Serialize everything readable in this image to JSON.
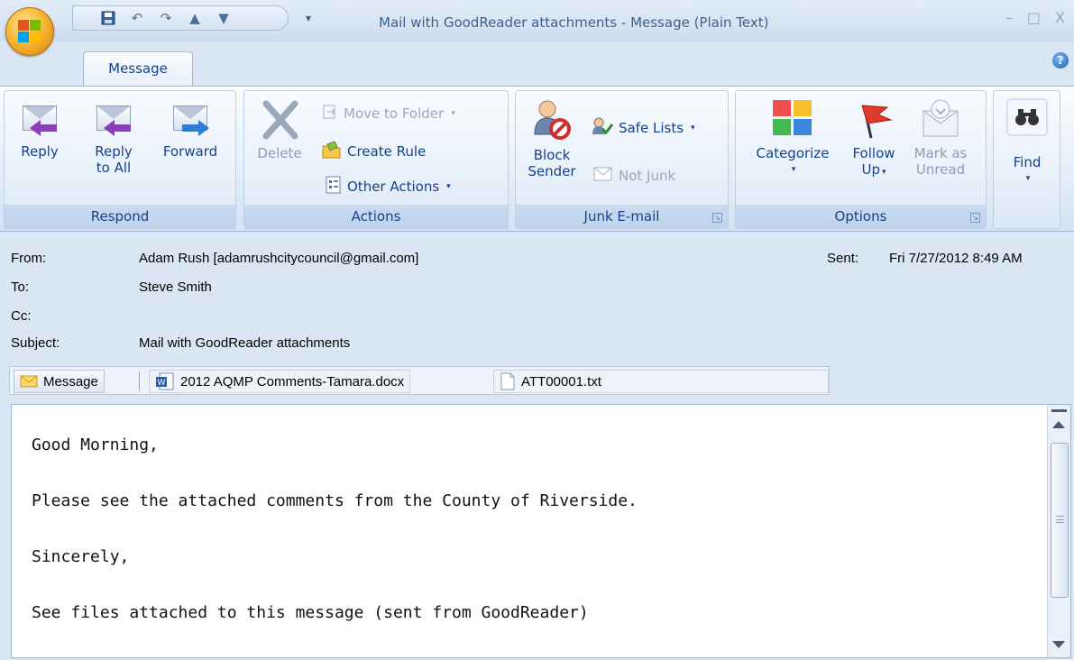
{
  "window": {
    "title": "Mail with GoodReader attachments - Message (Plain Text)",
    "controls": [
      "–",
      "□",
      "X"
    ]
  },
  "quick_access": {
    "icons": [
      "save-icon",
      "undo-icon",
      "redo-icon",
      "up-arrow-icon",
      "down-arrow-icon"
    ],
    "dropdown": "▾"
  },
  "ribbon": {
    "active_tab": "Message",
    "help": "?",
    "groups": {
      "respond": {
        "label": "Respond",
        "reply": "Reply",
        "reply_all_line1": "Reply",
        "reply_all_line2": "to All",
        "forward": "Forward"
      },
      "actions": {
        "label": "Actions",
        "delete": "Delete",
        "move_to_folder": "Move to Folder",
        "create_rule": "Create Rule",
        "other_actions": "Other Actions"
      },
      "junk": {
        "label": "Junk E-mail",
        "block_line1": "Block",
        "block_line2": "Sender",
        "safe_lists": "Safe Lists",
        "not_junk": "Not Junk"
      },
      "options": {
        "label": "Options",
        "categorize": "Categorize",
        "follow_line1": "Follow",
        "follow_line2": "Up",
        "mark_line1": "Mark as",
        "mark_line2": "Unread"
      },
      "find": {
        "label": "Find"
      }
    },
    "colors": {
      "accent": "#15428b",
      "reply_arrow": "#8a3fb8",
      "forward_arrow": "#2f7cd6"
    }
  },
  "headers": {
    "from_label": "From:",
    "from_value": "Adam Rush [adamrushcitycouncil@gmail.com]",
    "to_label": "To:",
    "to_value": "Steve Smith",
    "cc_label": "Cc:",
    "subject_label": "Subject:",
    "subject_value": "Mail with GoodReader attachments",
    "sent_label": "Sent:",
    "sent_value": "Fri 7/27/2012 8:49 AM"
  },
  "attachments": {
    "message_tab": "Message",
    "files": [
      "2012 AQMP Comments-Tamara.docx",
      "ATT00001.txt"
    ]
  },
  "body": {
    "lines": [
      "Good Morning,",
      "Please see the attached comments from the County of Riverside.",
      "Sincerely,",
      "See files attached to this message (sent from GoodReader)"
    ]
  }
}
